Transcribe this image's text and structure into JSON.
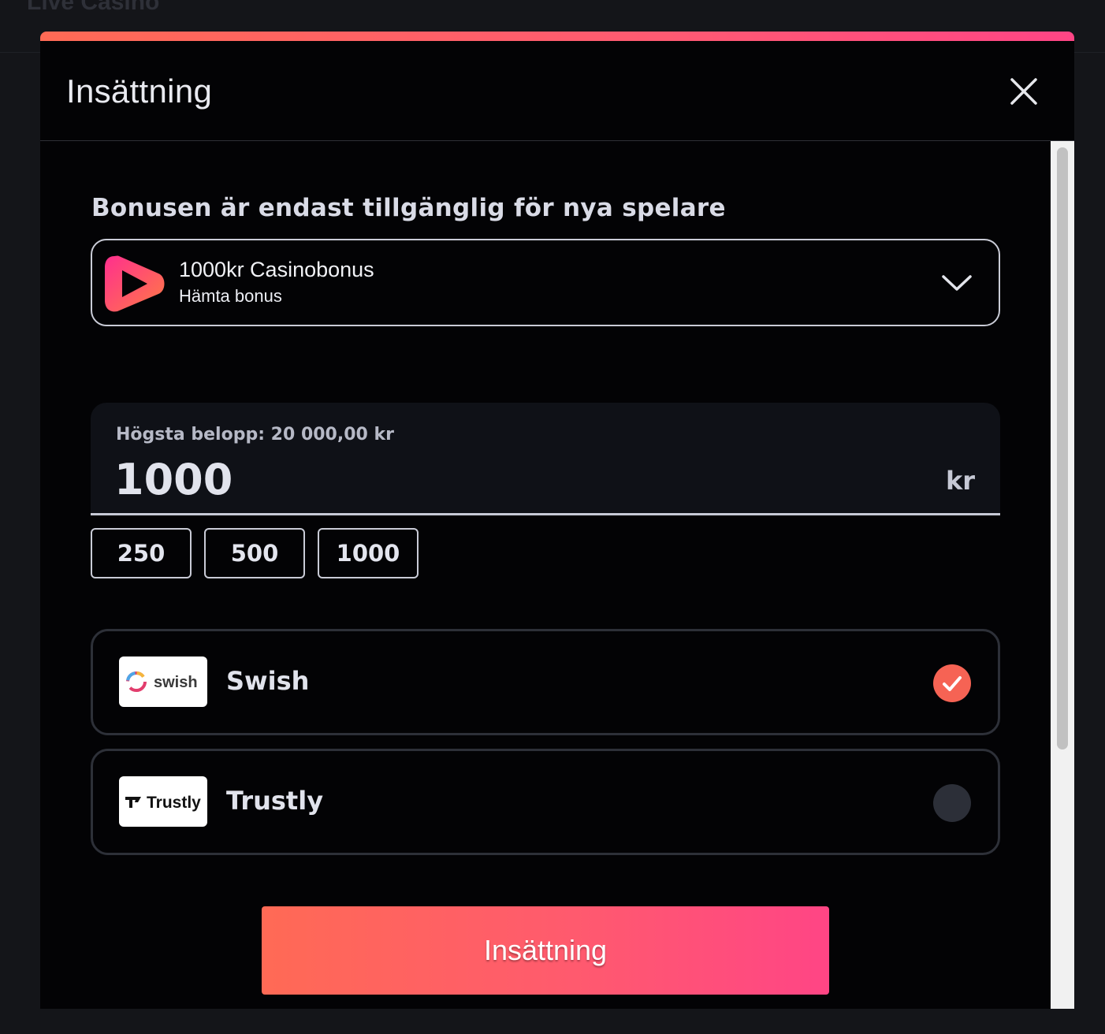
{
  "background": {
    "title": "Live Casino"
  },
  "modal": {
    "title": "Insättning",
    "accent_gradient": [
      "#ff6a55",
      "#ff4585"
    ],
    "close_icon": "close-icon"
  },
  "bonus": {
    "heading": "Bonusen är endast tillgänglig för nya spelare",
    "selected": {
      "name": "1000kr Casinobonus",
      "subtitle": "Hämta bonus",
      "icon": "play-logo-icon"
    },
    "dropdown_icon": "chevron-down-icon"
  },
  "amount": {
    "label": "Högsta belopp: 20 000,00 kr",
    "value": "1000",
    "unit": "kr",
    "quick_amounts": [
      "250",
      "500",
      "1000"
    ]
  },
  "payment_methods": [
    {
      "name": "Swish",
      "logo_text": "swish",
      "selected": true
    },
    {
      "name": "Trustly",
      "logo_text": "Trustly",
      "selected": false
    }
  ],
  "submit": {
    "label": "Insättning"
  }
}
